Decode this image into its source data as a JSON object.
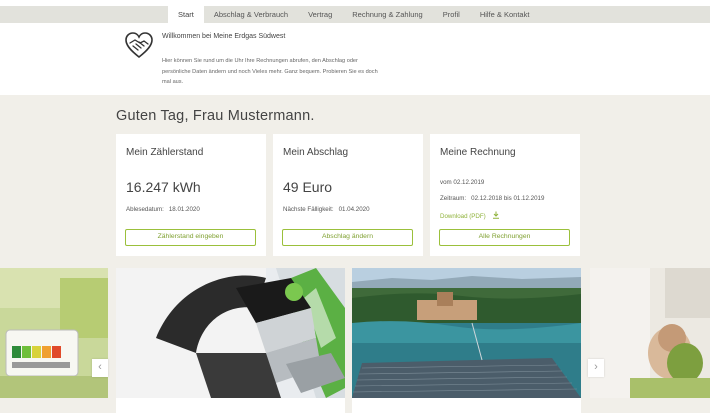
{
  "nav": {
    "items": [
      {
        "label": "Start",
        "active": true
      },
      {
        "label": "Abschlag & Verbrauch",
        "active": false
      },
      {
        "label": "Vertrag",
        "active": false
      },
      {
        "label": "Rechnung & Zahlung",
        "active": false
      },
      {
        "label": "Profil",
        "active": false
      },
      {
        "label": "Hilfe & Kontakt",
        "active": false
      }
    ]
  },
  "welcome": {
    "icon": "handshake-heart-icon",
    "title": "Willkommen bei Meine Erdgas Südwest",
    "text": "Hier können Sie rund um die Uhr Ihre Rechnungen abrufen, den Abschlag oder persönliche Daten ändern und noch Vieles mehr. Ganz bequem. Probieren Sie es doch mal aus."
  },
  "greeting": "Guten Tag, Frau Mustermann.",
  "cards": {
    "zaehlerstand": {
      "title": "Mein Zählerstand",
      "value": "16.247 kWh",
      "date_label": "Ablesedatum:",
      "date_value": "18.01.2020",
      "button": "Zählerstand eingeben"
    },
    "abschlag": {
      "title": "Mein Abschlag",
      "value": "49 Euro",
      "due_label": "Nächste Fälligkeit:",
      "due_value": "01.04.2020",
      "button": "Abschlag ändern"
    },
    "rechnung": {
      "title": "Meine Rechnung",
      "date_line": "vom 02.12.2019",
      "period_label": "Zeitraum:",
      "period_value": "02.12.2018 bis 01.12.2019",
      "download_label": "Download (PDF)",
      "download_icon": "download-icon",
      "button": "Alle Rechnungen"
    }
  },
  "carousel": {
    "prev_icon": "chevron-left-icon",
    "next_icon": "chevron-right-icon",
    "prev_glyph": "‹",
    "next_glyph": "›"
  },
  "colors": {
    "accent": "#9bc03b",
    "hero_bg": "#f1efe9",
    "nav_bg": "#e2e2dc"
  }
}
